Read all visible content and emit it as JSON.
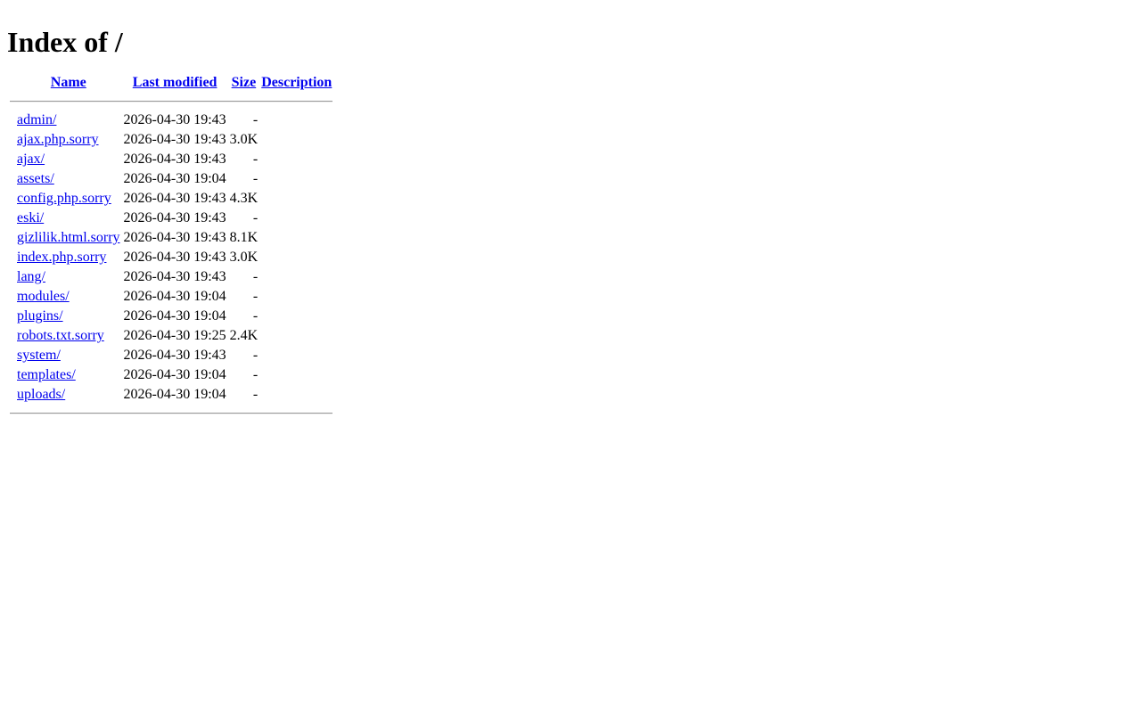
{
  "page": {
    "title": "Index of /"
  },
  "table": {
    "headers": {
      "name": "Name",
      "last_modified": "Last modified",
      "size": "Size",
      "description": "Description"
    },
    "rows": [
      {
        "name": "admin/",
        "modified": "2026-04-30 19:43",
        "size": "-",
        "description": ""
      },
      {
        "name": "ajax.php.sorry",
        "modified": "2026-04-30 19:43",
        "size": "3.0K",
        "description": ""
      },
      {
        "name": "ajax/",
        "modified": "2026-04-30 19:43",
        "size": "-",
        "description": ""
      },
      {
        "name": "assets/",
        "modified": "2026-04-30 19:04",
        "size": "-",
        "description": ""
      },
      {
        "name": "config.php.sorry",
        "modified": "2026-04-30 19:43",
        "size": "4.3K",
        "description": ""
      },
      {
        "name": "eski/",
        "modified": "2026-04-30 19:43",
        "size": "-",
        "description": ""
      },
      {
        "name": "gizlilik.html.sorry",
        "modified": "2026-04-30 19:43",
        "size": "8.1K",
        "description": ""
      },
      {
        "name": "index.php.sorry",
        "modified": "2026-04-30 19:43",
        "size": "3.0K",
        "description": ""
      },
      {
        "name": "lang/",
        "modified": "2026-04-30 19:43",
        "size": "-",
        "description": ""
      },
      {
        "name": "modules/",
        "modified": "2026-04-30 19:04",
        "size": "-",
        "description": ""
      },
      {
        "name": "plugins/",
        "modified": "2026-04-30 19:04",
        "size": "-",
        "description": ""
      },
      {
        "name": "robots.txt.sorry",
        "modified": "2026-04-30 19:25",
        "size": "2.4K",
        "description": ""
      },
      {
        "name": "system/",
        "modified": "2026-04-30 19:43",
        "size": "-",
        "description": ""
      },
      {
        "name": "templates/",
        "modified": "2026-04-30 19:04",
        "size": "-",
        "description": ""
      },
      {
        "name": "uploads/",
        "modified": "2026-04-30 19:04",
        "size": "-",
        "description": ""
      }
    ]
  },
  "colors": {
    "link": "#0000ee",
    "text": "#000000",
    "background": "#ffffff"
  }
}
